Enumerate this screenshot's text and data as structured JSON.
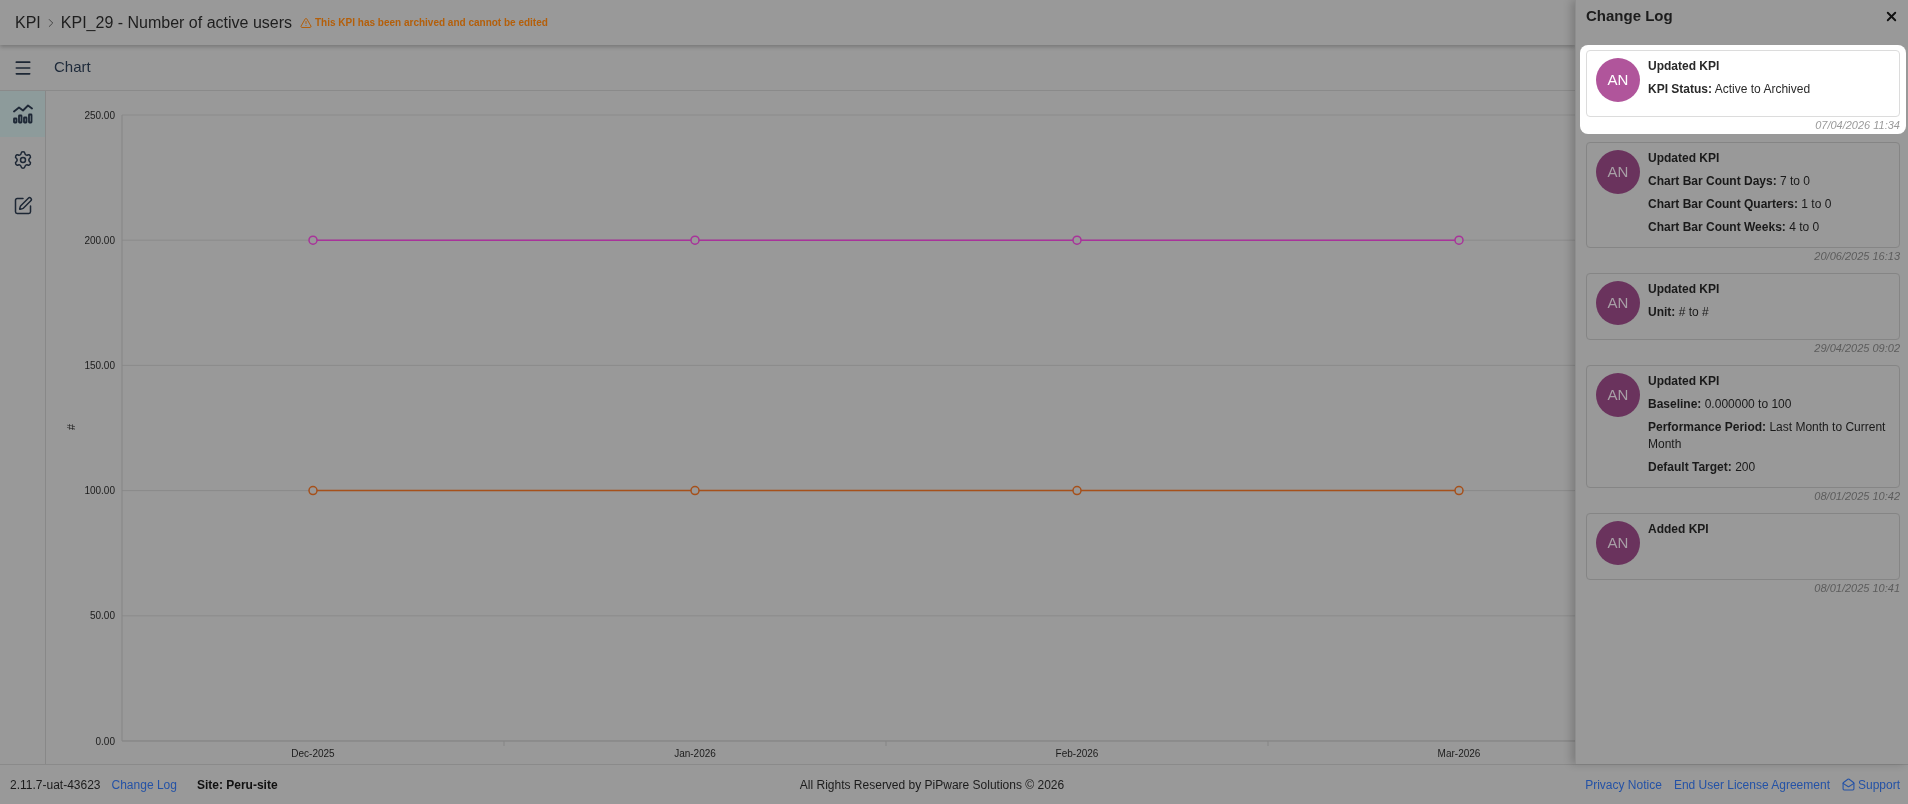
{
  "header": {
    "breadcrumb": [
      {
        "label": "KPI"
      },
      {
        "label": "KPI_29 - Number of active users"
      }
    ],
    "warning": "This KPI has been archived and cannot be edited"
  },
  "toolbar": {
    "title": "Chart"
  },
  "sidebar": {
    "items": [
      {
        "kind": "chart",
        "selected": true
      },
      {
        "kind": "settings",
        "selected": false
      },
      {
        "kind": "edit",
        "selected": false
      }
    ]
  },
  "chart": {
    "chart_data": {
      "type": "line",
      "ylabel": "#",
      "categories": [
        "Dec-2025",
        "Jan-2026",
        "Feb-2026",
        "Mar-2026"
      ],
      "series": [
        {
          "color": "#a8339a",
          "marker": "circle",
          "values": [
            200,
            200,
            200,
            200
          ]
        },
        {
          "color": "#a6501a",
          "marker": "circle",
          "values": [
            100,
            100,
            100,
            100
          ]
        }
      ],
      "ylim": [
        0,
        250
      ],
      "yticks": [
        {
          "value": 0,
          "label": "0.00"
        },
        {
          "value": 50,
          "label": "50.00"
        },
        {
          "value": 100,
          "label": "100.00"
        },
        {
          "value": 150,
          "label": "150.00"
        },
        {
          "value": 200,
          "label": "200.00"
        },
        {
          "value": 250,
          "label": "250.00"
        }
      ],
      "grid": true
    }
  },
  "change_log": {
    "title": "Change Log",
    "entries": [
      {
        "highlighted": true,
        "initials": "AN",
        "title": "Updated KPI",
        "details": [
          "**KPI Status:** Active to Archived"
        ],
        "timestamp": "07/04/2026 11:34"
      },
      {
        "highlighted": false,
        "initials": "AN",
        "title": "Updated KPI",
        "details": [
          "**Chart Bar Count Days:** 7 to 0",
          "**Chart Bar Count Quarters:** 1 to 0",
          "**Chart Bar Count Weeks:** 4 to 0"
        ],
        "timestamp": "20/06/2025 16:13"
      },
      {
        "highlighted": false,
        "initials": "AN",
        "title": "Updated KPI",
        "details": [
          "**Unit:** # to #"
        ],
        "timestamp": "29/04/2025 09:02"
      },
      {
        "highlighted": false,
        "initials": "AN",
        "title": "Updated KPI",
        "details": [
          "**Baseline:** 0.000000 to 100",
          "**Performance Period:** Last Month to Current Month",
          "**Default Target:** 200"
        ],
        "timestamp": "08/01/2025 10:42"
      },
      {
        "highlighted": false,
        "initials": "AN",
        "title": "Added KPI",
        "timestamp": "08/01/2025 10:41"
      }
    ]
  },
  "footer": {
    "version": "2.11.7-uat-43623",
    "change_log_link": "Change Log",
    "site": "Site: Peru-site",
    "copyright": "All Rights Reserved by PiPware Solutions © 2026",
    "links": [
      {
        "kind": "plain",
        "label": "Privacy Notice"
      },
      {
        "kind": "plain",
        "label": "End User License Agreement"
      },
      {
        "kind": "support",
        "label": "Support"
      }
    ]
  }
}
